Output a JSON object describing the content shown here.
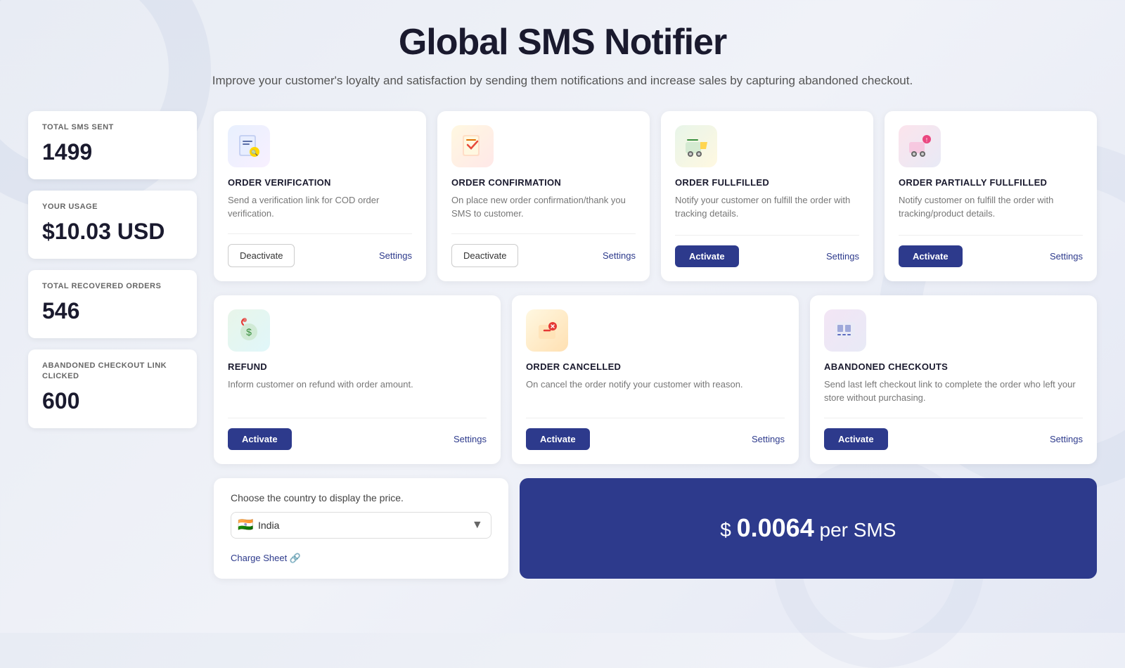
{
  "header": {
    "title": "Global SMS Notifier",
    "subtitle": "Improve your customer's loyalty and satisfaction by sending them notifications and increase sales by capturing abandoned checkout."
  },
  "sidebar": {
    "stats": [
      {
        "id": "total-sms-sent",
        "label": "TOTAL SMS SENT",
        "value": "1499"
      },
      {
        "id": "your-usage",
        "label": "YOUR USAGE",
        "value": "$10.03 USD"
      },
      {
        "id": "total-recovered-orders",
        "label": "TOTAL RECOVERED ORDERS",
        "value": "546"
      },
      {
        "id": "abandoned-checkout-link-clicked",
        "label": "ABANDONED CHECKOUT LINK CLICKED",
        "value": "600"
      }
    ]
  },
  "cards_row1": [
    {
      "id": "order-verification",
      "icon": "📋",
      "title": "ORDER VERIFICATION",
      "desc": "Send a verification link for COD order verification.",
      "button": "Deactivate",
      "button_type": "deactivate",
      "settings": "Settings"
    },
    {
      "id": "order-confirmation",
      "icon": "📝",
      "title": "ORDER CONFIRMATION",
      "desc": "On place new order confirmation/thank you SMS to customer.",
      "button": "Deactivate",
      "button_type": "deactivate",
      "settings": "Settings"
    },
    {
      "id": "order-fulfilled",
      "icon": "🚚",
      "title": "ORDER FULLFILLED",
      "desc": "Notify your customer on fulfill the order with tracking details.",
      "button": "Activate",
      "button_type": "activate",
      "settings": "Settings"
    },
    {
      "id": "order-partial",
      "icon": "🗺️",
      "title": "ORDER PARTIALLY FULLFILLED",
      "desc": "Notify customer on fulfill the order with tracking/product details.",
      "button": "Activate",
      "button_type": "activate",
      "settings": "Settings"
    }
  ],
  "cards_row2": [
    {
      "id": "refund",
      "icon": "💰",
      "title": "REFUND",
      "desc": "Inform customer on refund with order amount.",
      "button": "Activate",
      "button_type": "activate",
      "settings": "Settings"
    },
    {
      "id": "order-cancelled",
      "icon": "🛒",
      "title": "ORDER CANCELLED",
      "desc": "On cancel the order notify your customer with reason.",
      "button": "Activate",
      "button_type": "activate",
      "settings": "Settings"
    },
    {
      "id": "abandoned-checkouts",
      "icon": "🧾",
      "title": "ABANDONED CHECKOUTS",
      "desc": "Send last left checkout link to complete the order who left your store without purchasing.",
      "button": "Activate",
      "button_type": "activate",
      "settings": "Settings"
    }
  ],
  "country_section": {
    "label": "Choose the country to display the price.",
    "selected": "India",
    "flag": "🇮🇳",
    "charge_sheet": "Charge Sheet 🔗"
  },
  "price_banner": {
    "prefix": "$ ",
    "amount": "0.0064",
    "suffix": " per SMS"
  },
  "buttons": {
    "deactivate": "Deactivate",
    "activate": "Activate",
    "settings": "Settings"
  }
}
